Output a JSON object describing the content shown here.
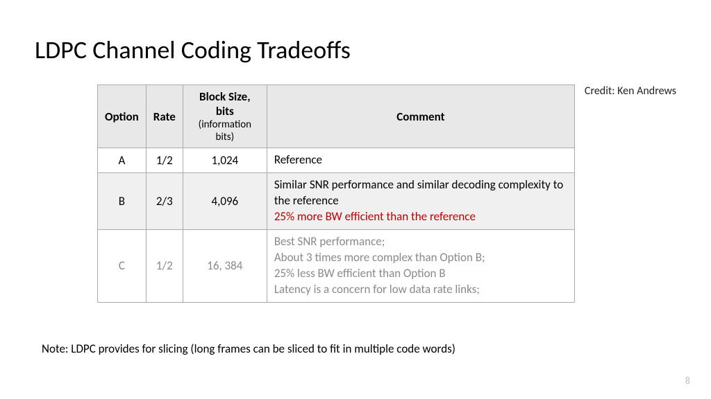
{
  "title": "LDPC Channel Coding Tradeoffs",
  "credit": "Credit: Ken Andrews",
  "headers": {
    "option": "Option",
    "rate": "Rate",
    "block_main": "Block Size, bits",
    "block_sub": "(information bits)",
    "comment": "Comment"
  },
  "rows": [
    {
      "option": "A",
      "rate": "1/2",
      "block": "1,024",
      "comment_lines": [
        {
          "text": "Reference",
          "style": "normal"
        }
      ],
      "alt": false,
      "faded": false
    },
    {
      "option": "B",
      "rate": "2/3",
      "block": "4,096",
      "comment_lines": [
        {
          "text": "Similar SNR performance and similar decoding complexity to the reference",
          "style": "normal"
        },
        {
          "text": "25% more BW efficient than the reference",
          "style": "red"
        }
      ],
      "alt": true,
      "faded": false
    },
    {
      "option": "C",
      "rate": "1/2",
      "block": "16, 384",
      "comment_lines": [
        {
          "text": "Best SNR performance;",
          "style": "normal"
        },
        {
          "text": "About 3 times more complex than  Option B;",
          "style": "normal"
        },
        {
          "text": "25% less BW efficient than Option B",
          "style": "normal"
        },
        {
          "text": "Latency is a concern for low data rate links;",
          "style": "normal"
        }
      ],
      "alt": false,
      "faded": true
    }
  ],
  "note": "Note: LDPC provides for slicing (long frames can be sliced to fit in multiple code words)",
  "page_number": "8"
}
